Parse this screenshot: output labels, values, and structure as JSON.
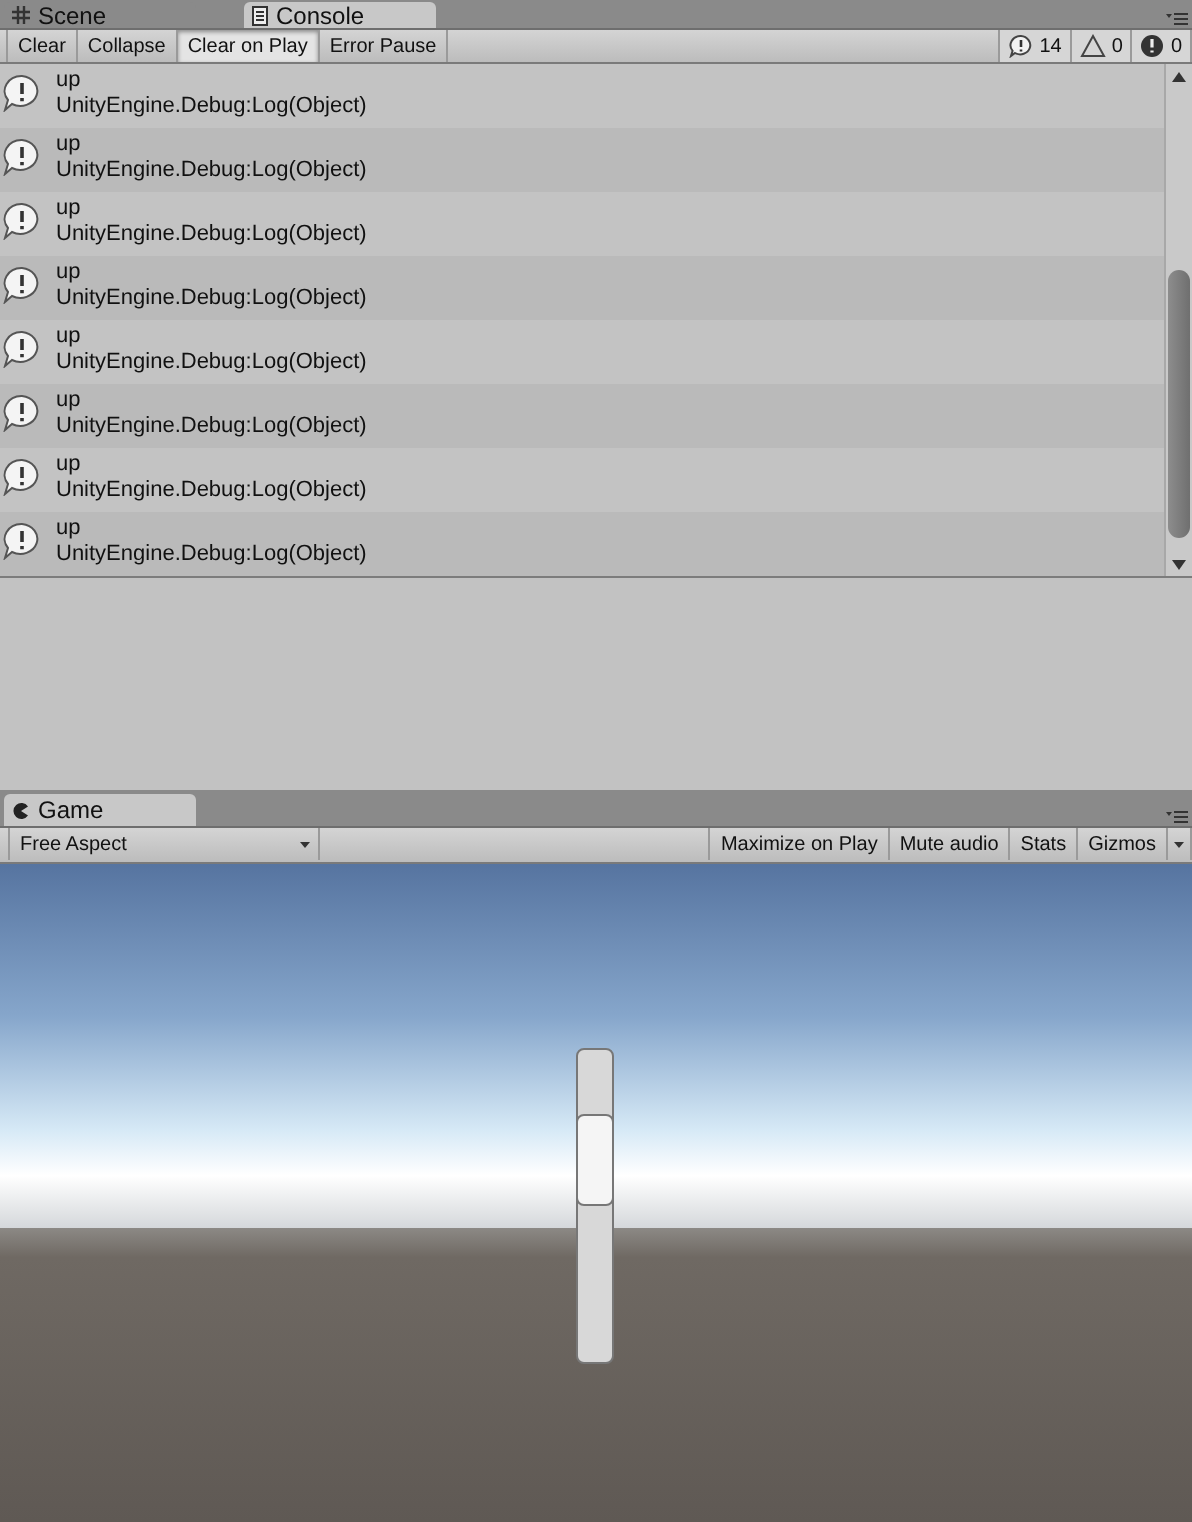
{
  "top_tabs": [
    {
      "label": "Scene",
      "kind": "grid",
      "selected": false
    },
    {
      "label": "Console",
      "kind": "doc",
      "selected": true
    }
  ],
  "console_toolbar": {
    "buttons": [
      {
        "label": "Clear",
        "selected": false
      },
      {
        "label": "Collapse",
        "selected": false
      },
      {
        "label": "Clear on Play",
        "selected": true
      },
      {
        "label": "Error Pause",
        "selected": false
      }
    ],
    "counters": [
      {
        "kind": "log",
        "count": "14"
      },
      {
        "kind": "warning",
        "count": "0"
      },
      {
        "kind": "error",
        "count": "0"
      }
    ]
  },
  "log_entries": [
    {
      "message": "up",
      "stack": "UnityEngine.Debug:Log(Object)"
    },
    {
      "message": "up",
      "stack": "UnityEngine.Debug:Log(Object)"
    },
    {
      "message": "up",
      "stack": "UnityEngine.Debug:Log(Object)"
    },
    {
      "message": "up",
      "stack": "UnityEngine.Debug:Log(Object)"
    },
    {
      "message": "up",
      "stack": "UnityEngine.Debug:Log(Object)"
    },
    {
      "message": "up",
      "stack": "UnityEngine.Debug:Log(Object)"
    },
    {
      "message": "up",
      "stack": "UnityEngine.Debug:Log(Object)"
    },
    {
      "message": "up",
      "stack": "UnityEngine.Debug:Log(Object)"
    }
  ],
  "game_tab": {
    "label": "Game"
  },
  "game_toolbar": {
    "aspect": "Free Aspect",
    "buttons": [
      {
        "label": "Maximize on Play",
        "selected": false
      },
      {
        "label": "Mute audio",
        "selected": false
      },
      {
        "label": "Stats",
        "selected": false
      },
      {
        "label": "Gizmos",
        "selected": false
      }
    ]
  }
}
